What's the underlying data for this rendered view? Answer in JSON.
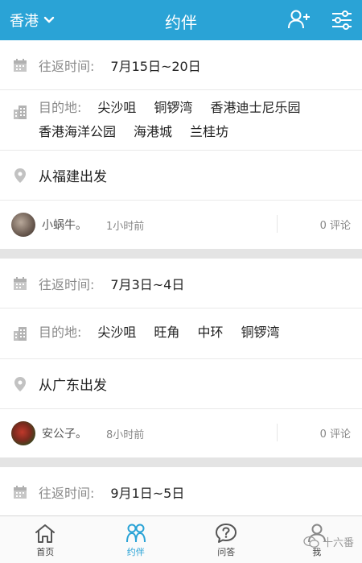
{
  "header": {
    "city": "香港",
    "title": "约伴",
    "accent": "#2aa3d6"
  },
  "posts": [
    {
      "date_label": "往返时间:",
      "date_value": "7月15日~20日",
      "dest_label": "目的地:",
      "destinations": [
        "尖沙咀",
        "铜锣湾",
        "香港迪士尼乐园",
        "香港海洋公园",
        "海港城",
        "兰桂坊"
      ],
      "from": "从福建出发",
      "user": "小蜗牛。",
      "time": "1小时前",
      "comments": "0 评论"
    },
    {
      "date_label": "往返时间:",
      "date_value": "7月3日~4日",
      "dest_label": "目的地:",
      "destinations": [
        "尖沙咀",
        "旺角",
        "中环",
        "铜锣湾"
      ],
      "from": "从广东出发",
      "user": "安公子。",
      "time": "8小时前",
      "comments": "0 评论"
    },
    {
      "date_label": "往返时间:",
      "date_value": "9月1日~5日"
    }
  ],
  "tabs": [
    {
      "label": "首页",
      "icon": "home-icon"
    },
    {
      "label": "约伴",
      "icon": "companions-icon"
    },
    {
      "label": "问答",
      "icon": "question-icon"
    },
    {
      "label": "我",
      "icon": "profile-icon"
    }
  ],
  "watermark": "十六番"
}
